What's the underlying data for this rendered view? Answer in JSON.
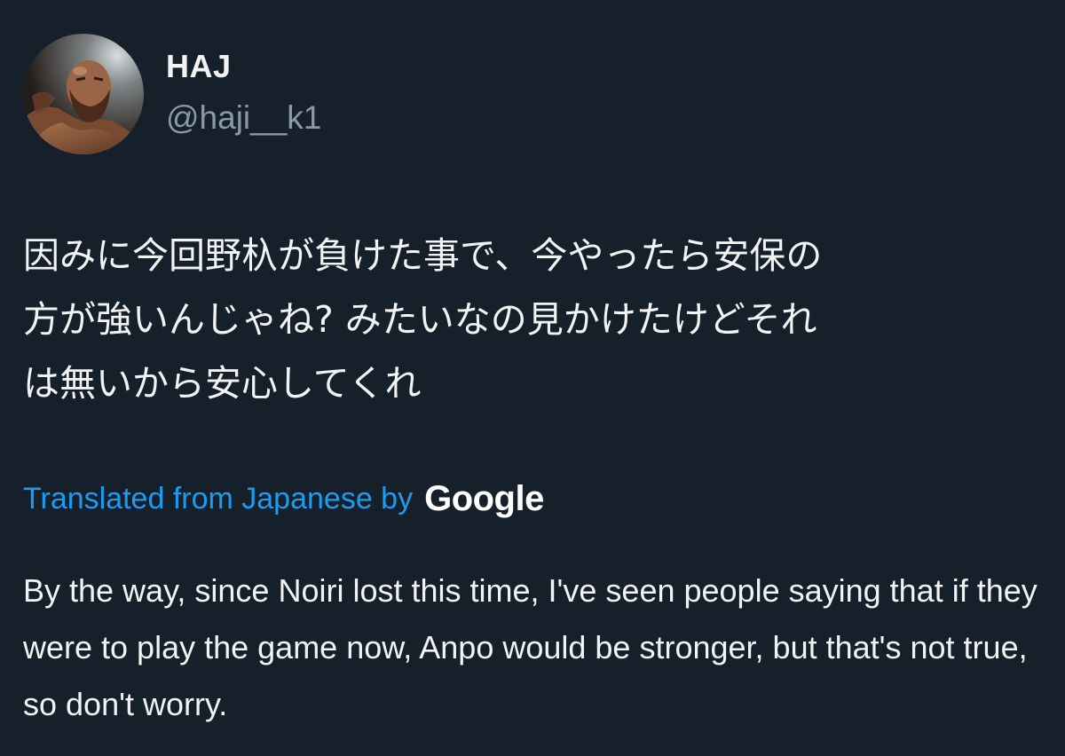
{
  "author": {
    "display_name": "HAJ",
    "handle": "@haji__k1",
    "avatar_icon": "profile-photo"
  },
  "tweet": {
    "text": "因みに今回野杁が負けた事で、今やったら安保の\n方が強いんじゃね? みたいなの見かけたけどそれ\nは無いから安心してくれ"
  },
  "translation": {
    "label": "Translated from Japanese by",
    "provider": "Google",
    "text": "By the way, since Noiri lost this time, I've seen people saying that if they were to play the game now, Anpo would be stronger, but that's not true, so don't worry."
  },
  "colors": {
    "background": "#15202b",
    "text": "#f2f3f4",
    "secondary_text": "#8b98a5",
    "link": "#1d9bf0"
  }
}
